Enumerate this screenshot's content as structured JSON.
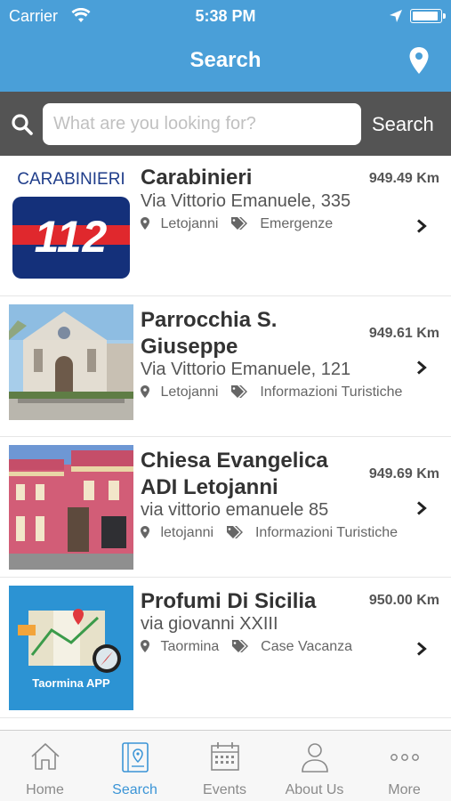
{
  "status_bar": {
    "carrier": "Carrier",
    "time": "5:38 PM"
  },
  "nav": {
    "title": "Search"
  },
  "search": {
    "placeholder": "What are you looking for?",
    "button_label": "Search"
  },
  "results": [
    {
      "name": "Carabinieri",
      "address": "Via Vittorio Emanuele, 335",
      "city": "Letojanni",
      "category": "Emergenze",
      "distance": "949.49 Km",
      "logo_text": "CARABINIERI",
      "logo_number": "112"
    },
    {
      "name": "Parrocchia S. Giuseppe",
      "address": "Via Vittorio Emanuele, 121",
      "city": "Letojanni",
      "category": "Informazioni Turistiche",
      "distance": "949.61 Km"
    },
    {
      "name": "Chiesa Evangelica ADI Letojanni",
      "address": "via vittorio emanuele 85",
      "city": "letojanni",
      "category": "Informazioni Turistiche",
      "distance": "949.69 Km"
    },
    {
      "name": "Profumi Di Sicilia",
      "address": "via giovanni XXIII",
      "city": "Taormina",
      "category": "Case Vacanza",
      "distance": "950.00 Km",
      "logo_text": "Taormina APP"
    }
  ],
  "tabs": [
    {
      "label": "Home",
      "icon": "home-icon"
    },
    {
      "label": "Search",
      "icon": "map-guide-icon",
      "active": true
    },
    {
      "label": "Events",
      "icon": "calendar-icon"
    },
    {
      "label": "About Us",
      "icon": "person-icon"
    },
    {
      "label": "More",
      "icon": "more-dots-icon"
    }
  ],
  "colors": {
    "primary": "#4a9fd8",
    "search_bar_bg": "#545454",
    "tab_active": "#3a94d6",
    "tab_inactive": "#8a8a8a"
  }
}
